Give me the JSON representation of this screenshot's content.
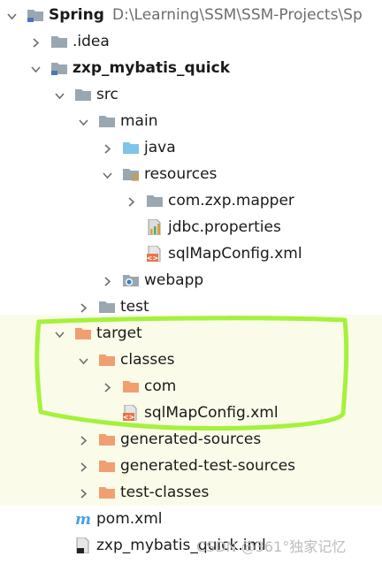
{
  "project": {
    "name": "Spring",
    "path": "D:\\Learning\\SSM\\SSM-Projects\\Sp"
  },
  "tree": [
    {
      "label": "Spring",
      "bold": true,
      "arrow": "down",
      "icon": "project-folder-icon",
      "depth": 0,
      "path_text": "D:\\Learning\\SSM\\SSM-Projects\\Sp"
    },
    {
      "label": ".idea",
      "arrow": "right",
      "icon": "folder-icon",
      "depth": 1
    },
    {
      "label": "zxp_mybatis_quick",
      "bold": true,
      "arrow": "down",
      "icon": "module-folder-icon",
      "depth": 1
    },
    {
      "label": "src",
      "arrow": "down",
      "icon": "folder-icon",
      "depth": 2
    },
    {
      "label": "main",
      "arrow": "down",
      "icon": "folder-icon",
      "depth": 3
    },
    {
      "label": "java",
      "arrow": "right",
      "icon": "source-folder-icon",
      "depth": 4
    },
    {
      "label": "resources",
      "arrow": "down",
      "icon": "resources-folder-icon",
      "depth": 4
    },
    {
      "label": "com.zxp.mapper",
      "arrow": "right",
      "icon": "folder-icon",
      "depth": 5
    },
    {
      "label": "jdbc.properties",
      "arrow": "none",
      "icon": "properties-file-icon",
      "depth": 5
    },
    {
      "label": "sqlMapConfig.xml",
      "arrow": "none",
      "icon": "xml-file-icon",
      "depth": 5
    },
    {
      "label": "webapp",
      "arrow": "right",
      "icon": "web-folder-icon",
      "depth": 4
    },
    {
      "label": "test",
      "arrow": "right",
      "icon": "folder-icon",
      "depth": 3
    },
    {
      "label": "target",
      "arrow": "down",
      "icon": "excluded-folder-icon",
      "depth": 2
    },
    {
      "label": "classes",
      "arrow": "down",
      "icon": "excluded-folder-icon",
      "depth": 3
    },
    {
      "label": "com",
      "arrow": "right",
      "icon": "excluded-folder-icon",
      "depth": 4
    },
    {
      "label": "sqlMapConfig.xml",
      "arrow": "none",
      "icon": "xml-file-icon",
      "depth": 4
    },
    {
      "label": "generated-sources",
      "arrow": "right",
      "icon": "excluded-folder-icon",
      "depth": 3
    },
    {
      "label": "generated-test-sources",
      "arrow": "right",
      "icon": "excluded-folder-icon",
      "depth": 3
    },
    {
      "label": "test-classes",
      "arrow": "right",
      "icon": "excluded-folder-icon",
      "depth": 3
    },
    {
      "label": "pom.xml",
      "arrow": "none",
      "icon": "maven-file-icon",
      "depth": 2
    },
    {
      "label": "zxp_mybatis_quick.iml",
      "arrow": "none",
      "icon": "iml-file-icon",
      "depth": 2
    }
  ],
  "highlighted_rows": [
    "target",
    "classes",
    "com",
    "sqlMapConfig.xml"
  ],
  "watermark": "CSDN @361°独家记忆",
  "colors": {
    "folder_gray": "#9aa7b0",
    "folder_excluded": "#f0a070",
    "folder_source": "#7fc4e8",
    "highlight_green": "#a4f23a",
    "excluded_band": "#fbfbea"
  }
}
